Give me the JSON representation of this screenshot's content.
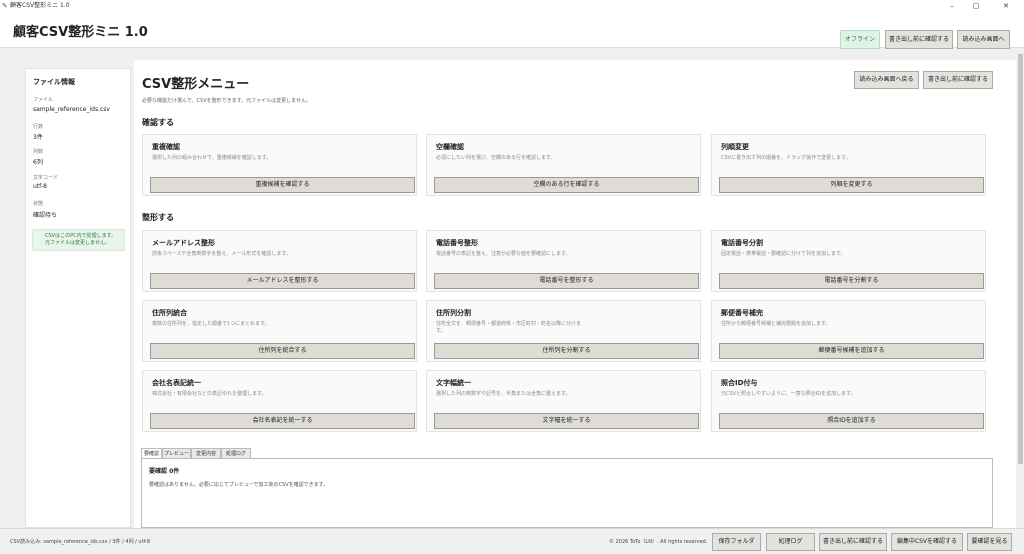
{
  "window": {
    "title": "顧客CSV整形ミニ 1.0",
    "controls": [
      "–",
      "▢",
      "✕"
    ]
  },
  "header": {
    "title": "顧客CSV整形ミニ 1.0",
    "status_badge": "オフライン",
    "confirm_export": "書き出し前に確認する",
    "to_import": "読み込み画面へ"
  },
  "sidebar": {
    "title": "ファイル情報",
    "fields": [
      {
        "label": "ファイル",
        "value": "sample_reference_ids.csv"
      },
      {
        "label": "行数",
        "value": "3件"
      },
      {
        "label": "列数",
        "value": "6列"
      },
      {
        "label": "文字コード",
        "value": "utf-8"
      },
      {
        "label": "状態",
        "value": "確認待ち"
      }
    ],
    "note_line1": "CSVはこのPC内で処理します。",
    "note_line2": "元ファイルは変更しません。"
  },
  "main": {
    "title": "CSV整形メニュー",
    "subtitle": "必要な機能だけ選んで、CSVを整形できます。元ファイルは変更しません。",
    "back_to_import": "読み込み画面へ戻る",
    "confirm_export": "書き出し前に確認する",
    "section_check": "確認する",
    "section_format": "整形する",
    "cards": [
      {
        "title": "重複確認",
        "desc": "選択した列の組み合わせで、重複候補を確認します。",
        "button": "重複候補を確認する"
      },
      {
        "title": "空欄確認",
        "desc": "必須にしたい列を選び、空欄のある行を確認します。",
        "button": "空欄のある行を確認する"
      },
      {
        "title": "列順変更",
        "desc": "CSVに書き出す列の順番を、ドラッグ操作で変更します。",
        "button": "列順を変更する"
      },
      {
        "title": "メールアドレス整形",
        "desc": "前後スペースや全角英数字を整え、メール形式を確認します。",
        "button": "メールアドレスを整形する"
      },
      {
        "title": "電話番号整形",
        "desc": "電話番号の表記を整え、注意が必要な値を要確認にします。",
        "button": "電話番号を整形する"
      },
      {
        "title": "電話番号分割",
        "desc": "固定電話・携帯電話・要確認に分けて列を追加します。",
        "button": "電話番号を分割する"
      },
      {
        "title": "住所列統合",
        "desc": "複数の住所列を、指定した順番で1つにまとめます。",
        "button": "住所列を統合する"
      },
      {
        "title": "住所列分割",
        "desc": "住所全文を、郵便番号・都道府県・市区町村・町名以降に分けます。",
        "button": "住所列を分割する"
      },
      {
        "title": "郵便番号補完",
        "desc": "住所から郵便番号候補と補完根拠を追加します。",
        "button": "郵便番号候補を追加する"
      },
      {
        "title": "会社名表記統一",
        "desc": "株式会社・有限会社などの表記ゆれを整理します。",
        "button": "会社名表記を統一する"
      },
      {
        "title": "文字幅統一",
        "desc": "選択した列の英数字や記号を、半角または全角に整えます。",
        "button": "文字幅を統一する"
      },
      {
        "title": "照合ID付与",
        "desc": "元CSVと照合しやすいように、一意な照合IDを追加します。",
        "button": "照合IDを追加する"
      }
    ],
    "tabs": [
      "要確認",
      "プレビュー",
      "変更内容",
      "処理ログ"
    ],
    "panel_title": "要確認 0件",
    "panel_text": "要確認はありません。必要に応じてプレビューで加工後のCSVを確認できます。"
  },
  "footer": {
    "status": "CSV読み込み: sample_reference_ids.csv / 3件 / 4列 / utf-8",
    "copyright": "© 2026 ToTo（LN）. All rights reserved.",
    "buttons": [
      "保存フォルダ",
      "処理ログ",
      "書き出し前に確認する",
      "編集中CSVを確認する",
      "要確認を見る"
    ]
  }
}
